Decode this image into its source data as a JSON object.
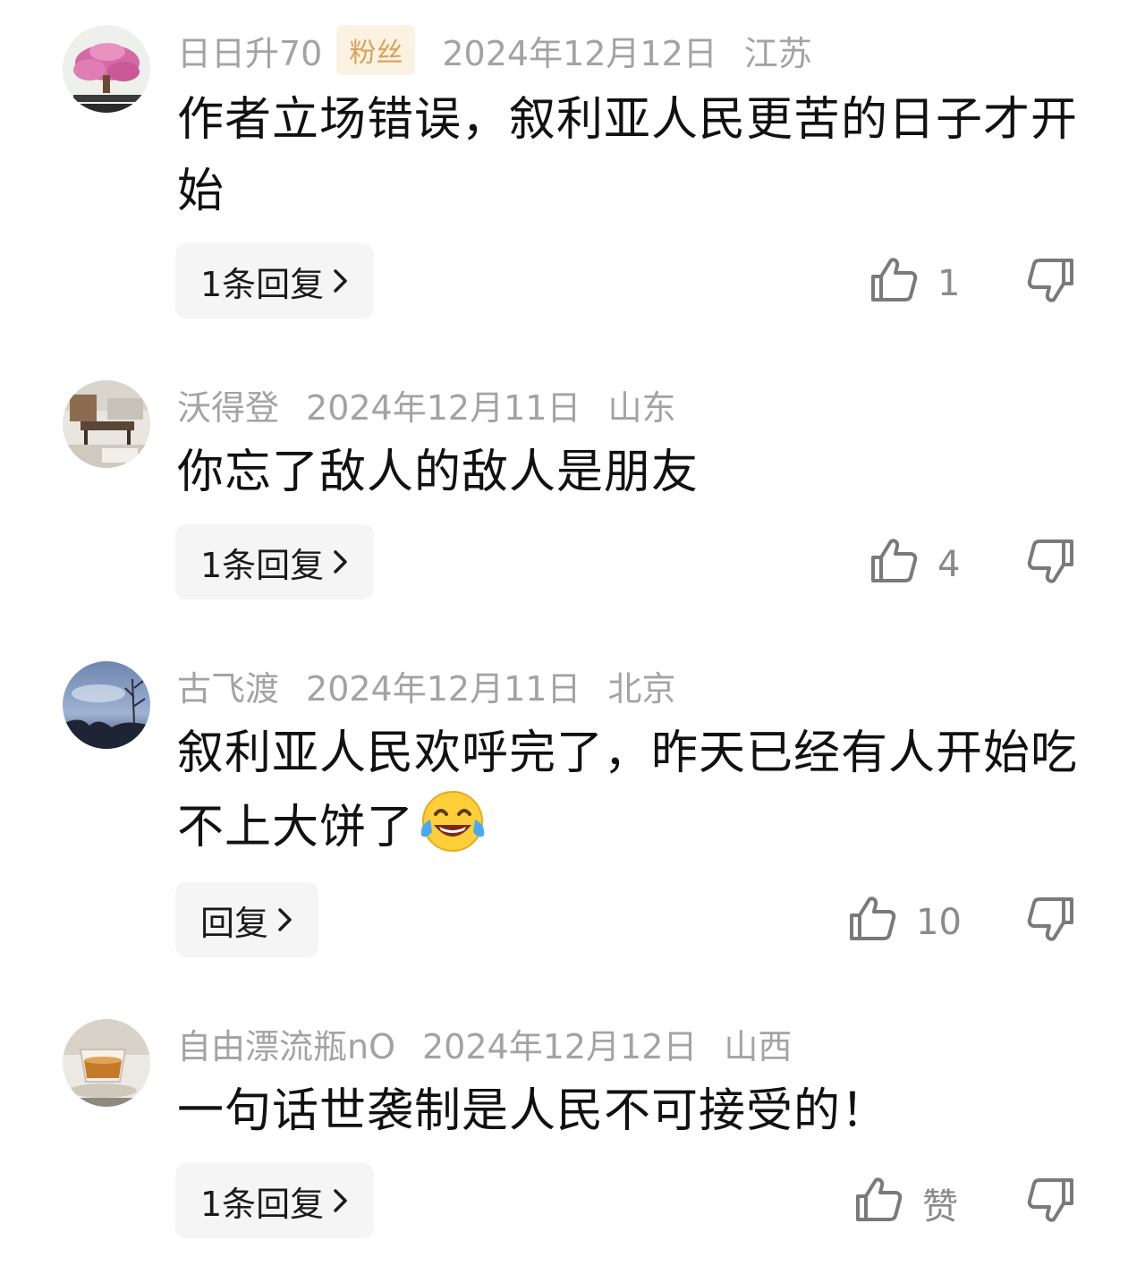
{
  "comments": [
    {
      "username": "日日升70",
      "badge": "粉丝",
      "date": "2024年12月12日",
      "location": "江苏",
      "text": "作者立场错误，叙利亚人民更苦的日子才开始",
      "reply_label": "1条回复",
      "like_count": "1",
      "avatar_icon": "bonsai-avatar"
    },
    {
      "username": "沃得登",
      "date": "2024年12月11日",
      "location": "山东",
      "text": "你忘了敌人的敌人是朋友",
      "reply_label": "1条回复",
      "like_count": "4",
      "avatar_icon": "room-interior-avatar"
    },
    {
      "username": "古飞渡",
      "date": "2024年12月11日",
      "location": "北京",
      "text": "叙利亚人民欢呼完了，昨天已经有人开始吃不上大饼了",
      "emoji": "tears-of-joy-emoji",
      "reply_label": "回复",
      "like_count": "10",
      "avatar_icon": "sky-trees-avatar"
    },
    {
      "username": "自由漂流瓶nO",
      "date": "2024年12月12日",
      "location": "山西",
      "text": "一句话世袭制是人民不可接受的！",
      "reply_label": "1条回复",
      "like_count": "赞",
      "avatar_icon": "tea-cup-avatar"
    }
  ],
  "colors": {
    "meta_text": "#a3a3a3",
    "badge_bg": "#fbf2e2",
    "badge_text": "#d6a35a",
    "body_text": "#111111",
    "reply_bg": "#f5f5f5",
    "icon_gray": "#7a7a7a"
  }
}
